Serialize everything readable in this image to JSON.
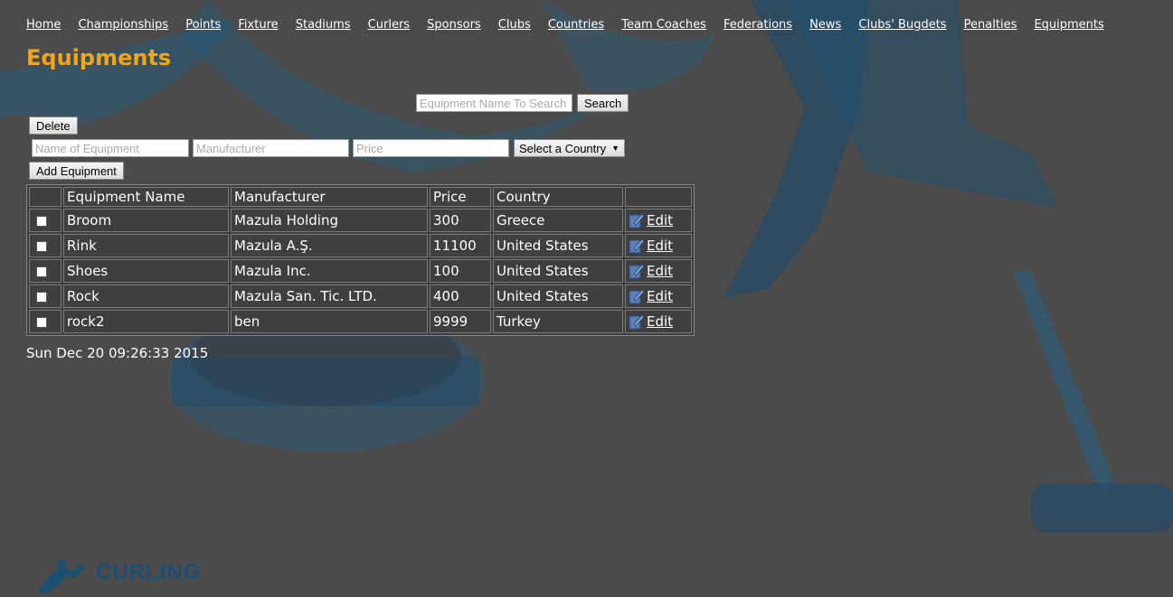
{
  "nav": {
    "items": [
      "Home",
      "Championships",
      "Points",
      "Fixture",
      "Stadiums",
      "Curlers",
      "Sponsors",
      "Clubs",
      "Countries",
      "Team Coaches",
      "Federations",
      "News",
      "Clubs' Bugdets",
      "Penalties",
      "Equipments"
    ]
  },
  "page_title": "Equipments",
  "search": {
    "placeholder": "Equipment Name To Search",
    "button": "Search"
  },
  "delete_button": "Delete",
  "form": {
    "name_placeholder": "Name of Equipment",
    "manufacturer_placeholder": "Manufacturer",
    "price_placeholder": "Price",
    "country_select": "Select a Country",
    "add_button": "Add Equipment"
  },
  "table": {
    "headers": [
      "",
      "Equipment Name",
      "Manufacturer",
      "Price",
      "Country",
      ""
    ],
    "rows": [
      {
        "name": "Broom",
        "manufacturer": "Mazula Holding",
        "price": "300",
        "country": "Greece",
        "edit": "Edit"
      },
      {
        "name": "Rink",
        "manufacturer": "Mazula A.Ş.",
        "price": "11100",
        "country": "United States",
        "edit": "Edit"
      },
      {
        "name": "Shoes",
        "manufacturer": "Mazula Inc.",
        "price": "100",
        "country": "United States",
        "edit": "Edit"
      },
      {
        "name": "Rock",
        "manufacturer": "Mazula San. Tic. LTD.",
        "price": "400",
        "country": "United States",
        "edit": "Edit"
      },
      {
        "name": "rock2",
        "manufacturer": "ben",
        "price": "9999",
        "country": "Turkey",
        "edit": "Edit"
      }
    ]
  },
  "timestamp": "Sun Dec 20 09:26:33 2015",
  "logo_text": "CURLING",
  "colors": {
    "title": "#f5a416",
    "background": "#4b4b4b",
    "accent_blue": "#1a4f73"
  }
}
